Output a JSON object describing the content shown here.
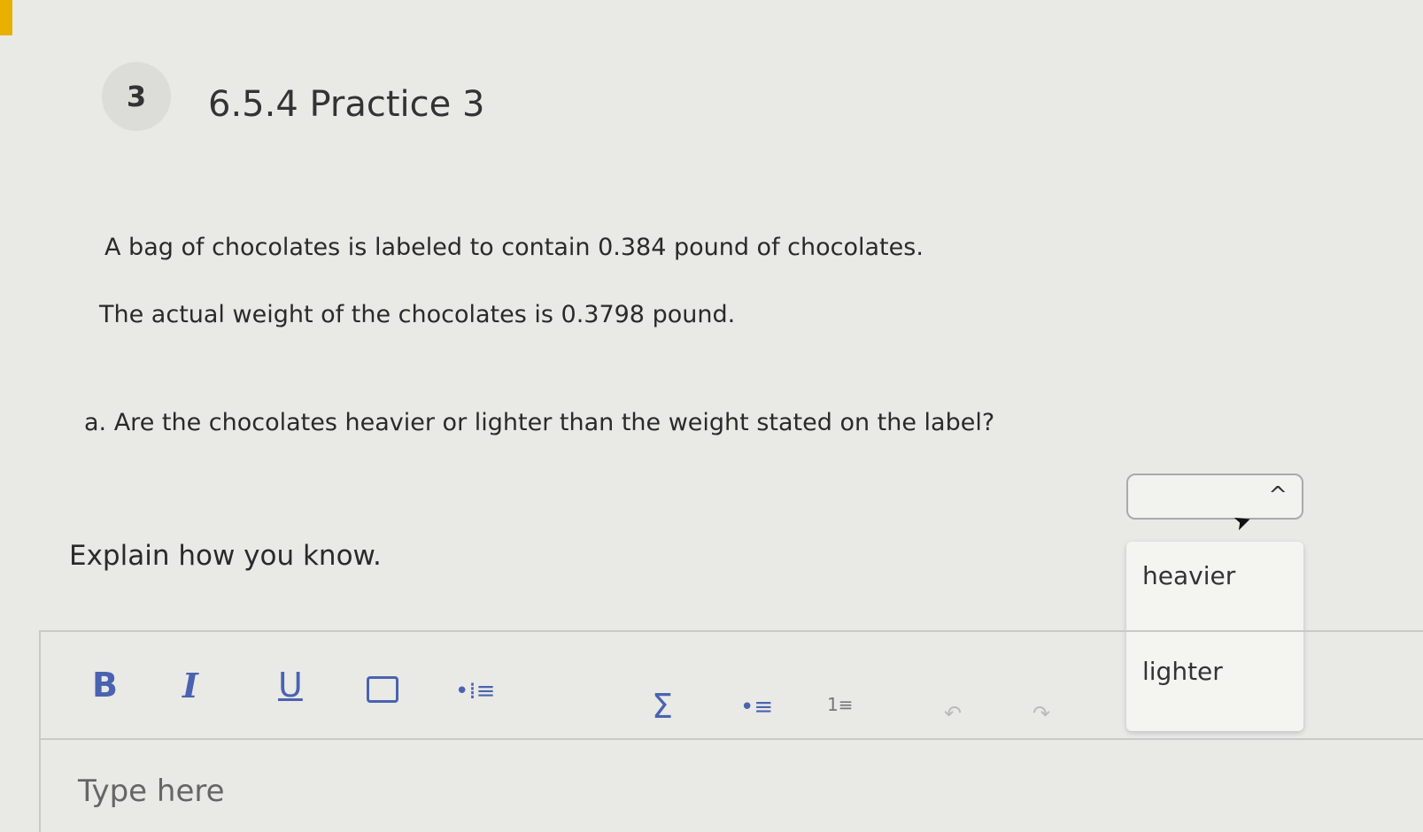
{
  "question": {
    "number": "3",
    "title": "6.5.4 Practice 3"
  },
  "prompt": {
    "line1": "A bag of chocolates is labeled to contain 0.384 pound of chocolates.",
    "line2": "The actual weight of the chocolates is 0.3798 pound.",
    "part_a": "a. Are the chocolates heavier or lighter than the weight stated on the label?",
    "explain": "Explain how you know."
  },
  "answer_select": {
    "value": "",
    "options": [
      "heavier",
      "lighter"
    ]
  },
  "toolbar": {
    "bold": "B",
    "italic": "I",
    "underline": "U",
    "indent": "•⁞≡",
    "sigma": "Σ",
    "bullets": "•≡",
    "numbers": "1≡",
    "undo": "↶",
    "redo": "↷"
  },
  "editor": {
    "placeholder": "Type here"
  },
  "colors": {
    "accent": "#e8b000",
    "toolbar_icon": "#4a63b0"
  }
}
